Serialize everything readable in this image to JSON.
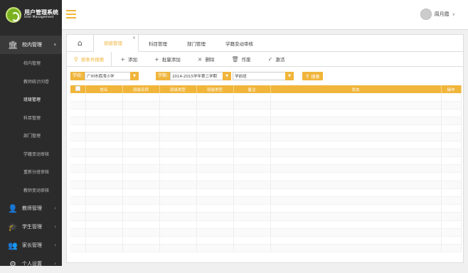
{
  "app": {
    "title": "用户管理系统",
    "subtitle": "User Management"
  },
  "user": {
    "name": "周月霞"
  },
  "sidebar": {
    "groups": [
      {
        "label": "校内管理",
        "icon": "bank-icon"
      },
      {
        "label": "教师管理",
        "icon": "teacher-icon"
      },
      {
        "label": "学生管理",
        "icon": "student-icon"
      },
      {
        "label": "家长管理",
        "icon": "parent-icon"
      },
      {
        "label": "个人设置",
        "icon": "gear-icon"
      }
    ],
    "subitems": [
      "校内管理",
      "教师统计问卷",
      "班级管理",
      "科目管理",
      "部门管理",
      "学籍变动审核",
      "重新分班审核",
      "教师变动审核"
    ]
  },
  "tabs": [
    "班级管理",
    "科目管理",
    "部门管理",
    "学籍变动审核"
  ],
  "toolbar": {
    "search": "按条件搜索",
    "add": "添加",
    "batch_add": "批量添加",
    "delete": "删除",
    "void": "作废",
    "activate": "激活"
  },
  "filters": {
    "school_label": "学校:",
    "school_value": "广州市荔湾小学",
    "term_label": "学期:",
    "term_value": "2014-2015学年第二学期",
    "grade_value": "学前班",
    "search_button": "搜索"
  },
  "table": {
    "columns": [
      "",
      "姓名",
      "班级名称",
      "班级类型",
      "班级类型",
      "备注",
      "状态",
      "操作"
    ],
    "row_count": 20
  },
  "colors": {
    "accent": "#f0b53b",
    "sidebar": "#2b2b2b"
  }
}
